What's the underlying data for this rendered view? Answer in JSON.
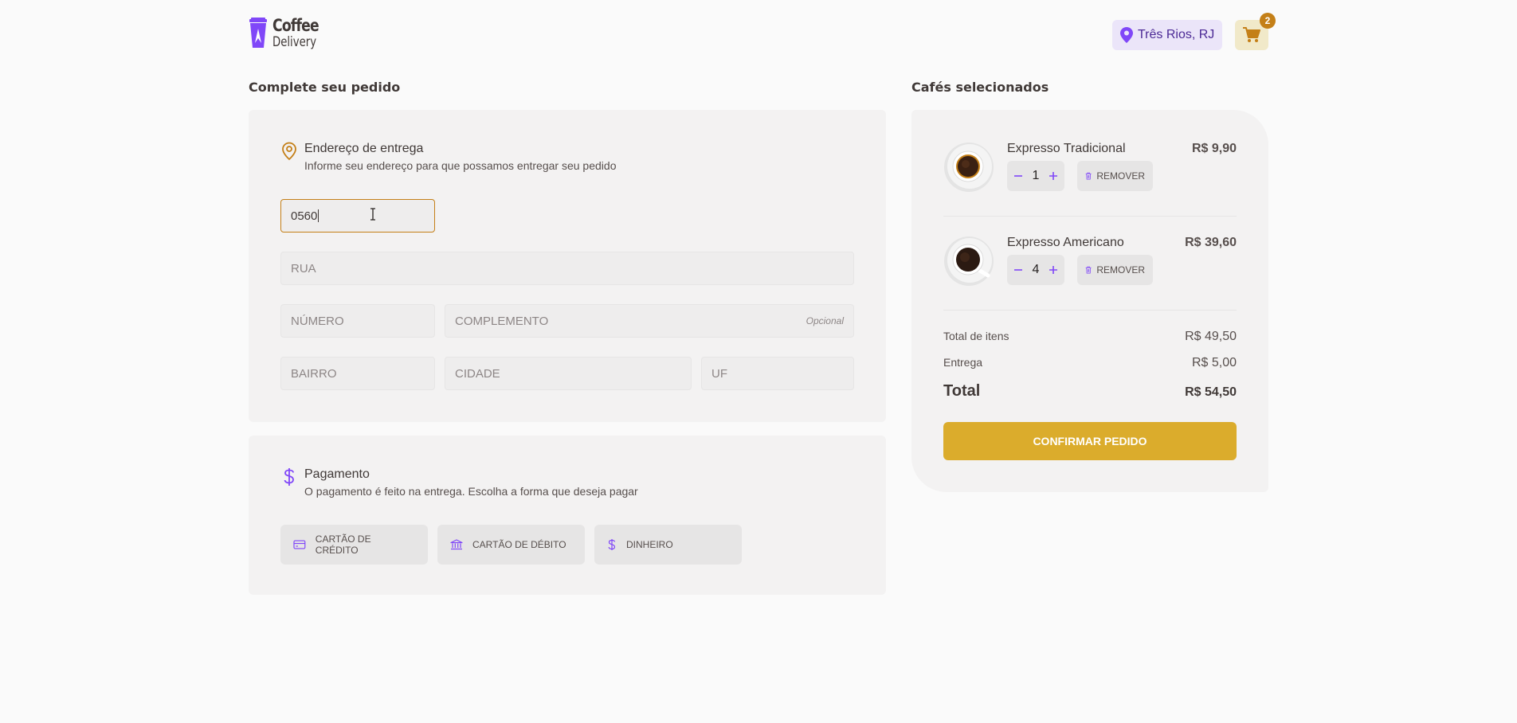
{
  "header": {
    "logo_line1": "Coffee",
    "logo_line2": "Delivery",
    "location": "Três Rios, RJ",
    "cart_count": "2"
  },
  "checkout": {
    "title": "Complete seu pedido",
    "address": {
      "title": "Endereço de entrega",
      "subtitle": "Informe seu endereço para que possamos entregar seu pedido",
      "cep_value": "0560",
      "rua_placeholder": "RUA",
      "numero_placeholder": "NÚMERO",
      "complemento_placeholder": "COMPLEMENTO",
      "complemento_optional": "Opcional",
      "bairro_placeholder": "BAIRRO",
      "cidade_placeholder": "CIDADE",
      "uf_placeholder": "UF"
    },
    "payment": {
      "title": "Pagamento",
      "subtitle": "O pagamento é feito na entrega. Escolha a forma que deseja pagar",
      "options": [
        "CARTÃO DE CRÉDITO",
        "CARTÃO DE DÉBITO",
        "DINHEIRO"
      ]
    }
  },
  "order": {
    "title": "Cafés selecionados",
    "items": [
      {
        "name": "Expresso Tradicional",
        "qty": "1",
        "price": "R$ 9,90",
        "remove_label": "REMOVER"
      },
      {
        "name": "Expresso Americano",
        "qty": "4",
        "price": "R$ 39,60",
        "remove_label": "REMOVER"
      }
    ],
    "totals": {
      "items_label": "Total de itens",
      "items_value": "R$ 49,50",
      "delivery_label": "Entrega",
      "delivery_value": "R$ 5,00",
      "total_label": "Total",
      "total_value": "R$ 54,50"
    },
    "confirm_label": "CONFIRMAR PEDIDO"
  },
  "colors": {
    "brand_purple": "#8047f8",
    "yellow": "#dbac2c",
    "yellow_dark": "#c47f17",
    "purple_light": "#ebe5f9"
  }
}
